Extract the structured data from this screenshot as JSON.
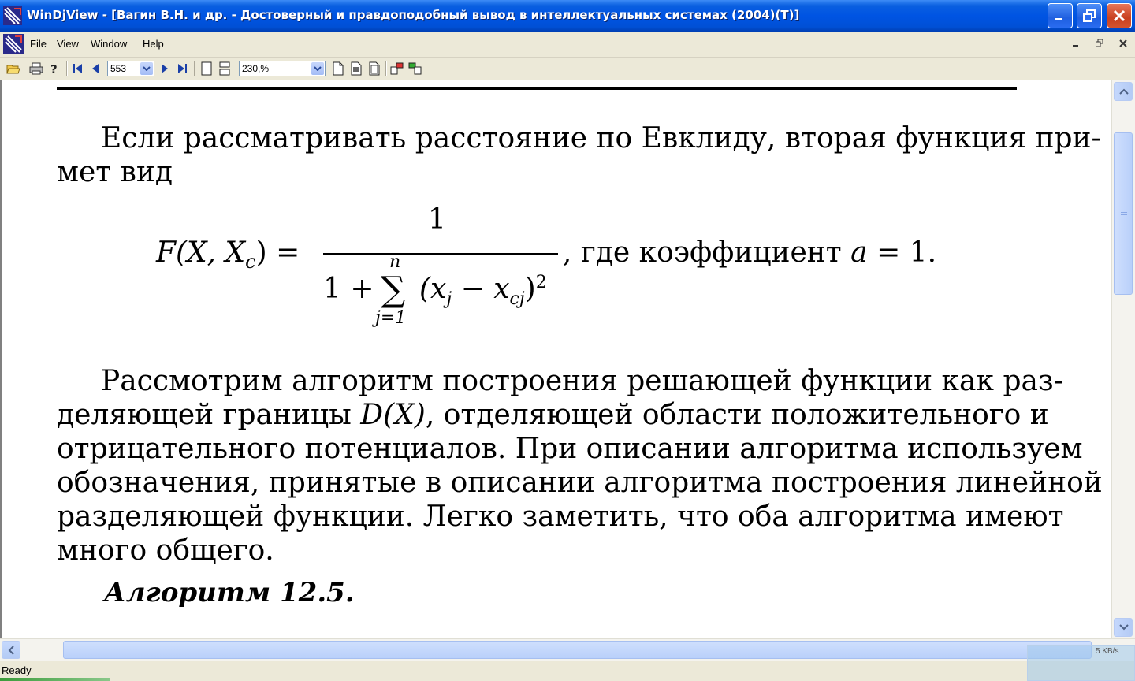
{
  "window": {
    "title": "WinDjView - [Вагин В.Н. и др. - Достоверный и правдоподобный вывод в интеллектуальных системах (2004)(Т)]"
  },
  "menu": {
    "file": "File",
    "view": "View",
    "window": "Window",
    "help": "Help"
  },
  "toolbar": {
    "page_number": "553",
    "zoom": "230,%",
    "icons": [
      "open-icon",
      "print-icon",
      "help-icon",
      "first-page-icon",
      "prev-page-icon",
      "next-page-icon",
      "last-page-icon",
      "single-page-icon",
      "continuous-icon",
      "actual-size-icon",
      "fit-width-icon",
      "fit-page-icon",
      "rotate-left-icon",
      "rotate-right-icon"
    ]
  },
  "document": {
    "para1": {
      "line1": "Если рассматривать расстояние по Евклиду, вторая функция при-",
      "line2": "мет вид"
    },
    "formula": {
      "lhs": "F(X, X",
      "lhs_sub": "c",
      "lhs_end": ") =",
      "numerator": "1",
      "den_prefix": "1 +",
      "sum_top": "n",
      "sum_bottom": "j=1",
      "den_term": "(x",
      "den_sub1": "j",
      "den_mid": " − x",
      "den_sub2": "cj",
      "den_end": ")",
      "den_sup": "2",
      "rhs_text": ",  где коэффициент ",
      "rhs_var": "a",
      "rhs_end": " = 1."
    },
    "para2": {
      "line1": "Рассмотрим алгоритм построения решающей функции как раз-",
      "line2a": "деляющей границы ",
      "line2_math": "D(X)",
      "line2b": ", отделяющей области положительного и",
      "line3": "отрицательного потенциалов. При описании алгоритма используем",
      "line4": "обозначения, принятые в описании алгоритма построения линейной",
      "line5": "разделяющей функции. Легко заметить, что оба алгоритма имеют",
      "line6": "много общего."
    },
    "algorithm_heading": "Алгоритм 12.5."
  },
  "status": {
    "text": "Ready",
    "speed": "5 KB/s"
  },
  "colors": {
    "titlebar": "#0054e3",
    "chrome": "#ece9d8",
    "close": "#c8401f"
  }
}
